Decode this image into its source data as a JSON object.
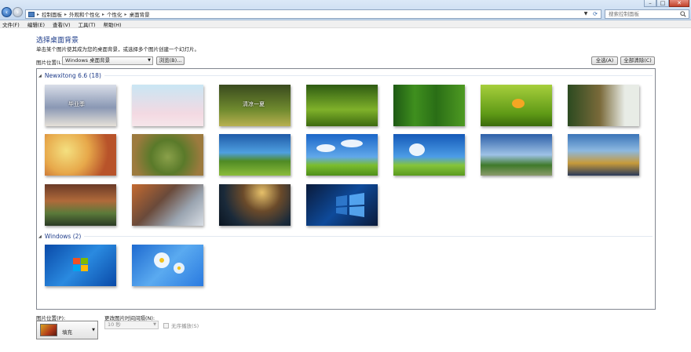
{
  "address_bar": {
    "breadcrumbs": [
      "控制面板",
      "外观和个性化",
      "个性化",
      "桌面背景"
    ],
    "search_placeholder": "搜索控制面板"
  },
  "menu": [
    "文件(F)",
    "编辑(E)",
    "查看(V)",
    "工具(T)",
    "帮助(H)"
  ],
  "header": {
    "title": "选择桌面背景",
    "description": "单击某个图片使其成为您的桌面背景，或选择多个图片创建一个幻灯片。"
  },
  "picture_location": {
    "label": "图片位置(L):",
    "value": "Windows 桌面背景",
    "browse_label": "浏览(B)..."
  },
  "buttons": {
    "select_all": "全选(A)",
    "clear_all": "全部清除(C)"
  },
  "groups": [
    {
      "name": "Newxitong 6.6 (18)",
      "thumbnails": [
        {
          "name": "bookshelf-thumb",
          "bg": "linear-gradient(180deg,#d8dde8,#8a98b4 55%,#e6e1d8)",
          "text": "毕业季"
        },
        {
          "name": "blossom-thumb",
          "bg": "linear-gradient(180deg,#c9e6f4,#f3d9e2 70%,#f6e6ea)"
        },
        {
          "name": "dandelion-thumb",
          "bg": "linear-gradient(180deg,#394a1e,#6f8a2e 60%,#b8b050)",
          "text": "清凉一夏"
        },
        {
          "name": "grass-thumb",
          "bg": "linear-gradient(180deg,#2e5b12,#7fb12a 60%,#3d6a10)"
        },
        {
          "name": "bamboo-thumb",
          "bg": "linear-gradient(90deg,#1e5a14,#3f8f1e 30%,#2a6e16 60%,#4e9a22)"
        },
        {
          "name": "tulip-thumb",
          "bg": "linear-gradient(180deg,#a7cf3c,#5f9a16 70%,#3b6a0c)"
        },
        {
          "name": "girl-thumb",
          "bg": "linear-gradient(90deg,#2b4a20,#7a6a3a 45%,#e8ece6 80%)"
        },
        {
          "name": "plumeria-thumb",
          "bg": "radial-gradient(circle at 30% 40%,#f4e080,#e7a84a 40%,#b8532a 75%)"
        },
        {
          "name": "spiral-field-thumb",
          "bg": "radial-gradient(circle at 50% 55%,#8aa04a,#5a7a2a 40%,#9c7a3e 80%)"
        },
        {
          "name": "farm-thumb",
          "bg": "linear-gradient(180deg,#1e5aa8,#4fa0e0 45%,#4f8a24 65%,#8bbc3a)"
        },
        {
          "name": "clouds-field-thumb",
          "bg": "linear-gradient(180deg,#1b66c8,#61a8ea 55%,#7bbd2e 75%,#4e8f1a)"
        },
        {
          "name": "sky-meadow-thumb",
          "bg": "linear-gradient(180deg,#1459b8,#4d9de6 55%,#85c43a 75%,#5a9a1e)"
        },
        {
          "name": "windmill-thumb",
          "bg": "linear-gradient(180deg,#2c5fa8,#9ec2e6 50%,#3f7a2a 75%,#8a9a6a)"
        },
        {
          "name": "sea-arch-thumb",
          "bg": "linear-gradient(180deg,#3a74b8,#8cb8e0 40%,#c79a3a 70%,#2a3a5a)"
        },
        {
          "name": "canyon-river-thumb",
          "bg": "linear-gradient(180deg,#6a3a28,#b06a3a 40%,#5a7a3a 70%,#2a3a24)"
        },
        {
          "name": "mountain-thumb",
          "bg": "linear-gradient(135deg,#c46a30,#6a4a3a 40%,#9aa4b0 70%,#d8dde4)"
        },
        {
          "name": "planet-thumb",
          "bg": "radial-gradient(circle at 60% 20%,#e6c06a,#6a4a2a 35%,#1a2a3a 70%,#0a1420)"
        },
        {
          "name": "win10-thumb",
          "bg": "linear-gradient(135deg,#0a1a3a,#0e4a9a 50%,#0a1a3a)"
        }
      ]
    },
    {
      "name": "Windows (2)",
      "thumbnails": [
        {
          "name": "win7-thumb",
          "bg": "linear-gradient(135deg,#0a4aa8,#2a8ae0 50%,#0a4aa8)"
        },
        {
          "name": "daisy-thumb",
          "bg": "linear-gradient(135deg,#1e6ad0,#5aaaf0 50%,#2a7ae0)"
        }
      ]
    }
  ],
  "position": {
    "label": "图片位置(P):",
    "value": "填充"
  },
  "interval": {
    "label": "更改图片时间间隔(N):",
    "value": "10 秒"
  },
  "shuffle_label": "无序播放(S)"
}
